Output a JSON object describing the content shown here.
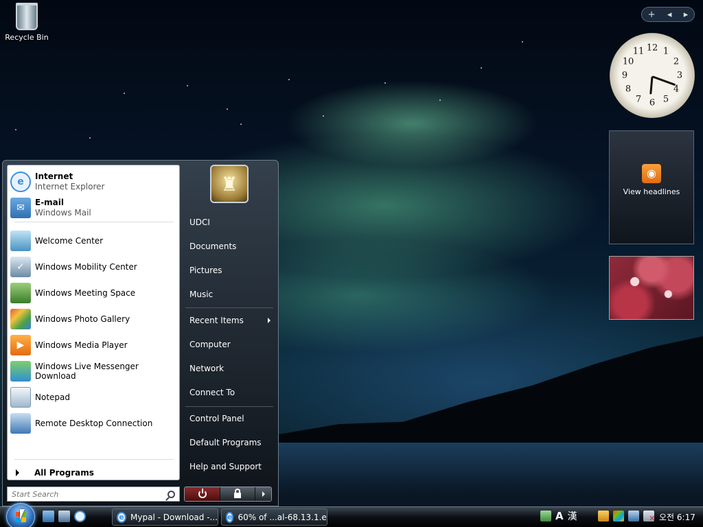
{
  "desktop": {
    "recycle_bin_label": "Recycle Bin"
  },
  "gadgets": {
    "add_label": "+",
    "prev_label": "◂",
    "next_label": "▸",
    "clock_numbers": [
      "12",
      "1",
      "2",
      "3",
      "4",
      "5",
      "6",
      "7",
      "8",
      "9",
      "10",
      "11"
    ],
    "rss_label": "View headlines"
  },
  "start_menu": {
    "pinned": [
      {
        "title": "Internet",
        "subtitle": "Internet Explorer"
      },
      {
        "title": "E-mail",
        "subtitle": "Windows Mail"
      }
    ],
    "recent": [
      "Welcome Center",
      "Windows Mobility Center",
      "Windows Meeting Space",
      "Windows Photo Gallery",
      "Windows Media Player",
      "Windows Live Messenger Download",
      "Notepad",
      "Remote Desktop Connection"
    ],
    "all_programs": "All Programs",
    "search_placeholder": "Start Search",
    "right": {
      "user": "UDCI",
      "documents": "Documents",
      "pictures": "Pictures",
      "music": "Music",
      "recent_items": "Recent Items",
      "computer": "Computer",
      "network": "Network",
      "connect_to": "Connect To",
      "control_panel": "Control Panel",
      "default_programs": "Default Programs",
      "help_support": "Help and Support"
    }
  },
  "taskbar": {
    "tasks": [
      {
        "label": "Mypal - Download -..."
      },
      {
        "label": "60% of ...al-68.13.1.e..."
      }
    ],
    "ime_a": "A",
    "ime_han": "漢",
    "time": "오전 6:17"
  },
  "colors": {
    "accent": "#2c6fba",
    "rss": "#f7a23c"
  }
}
